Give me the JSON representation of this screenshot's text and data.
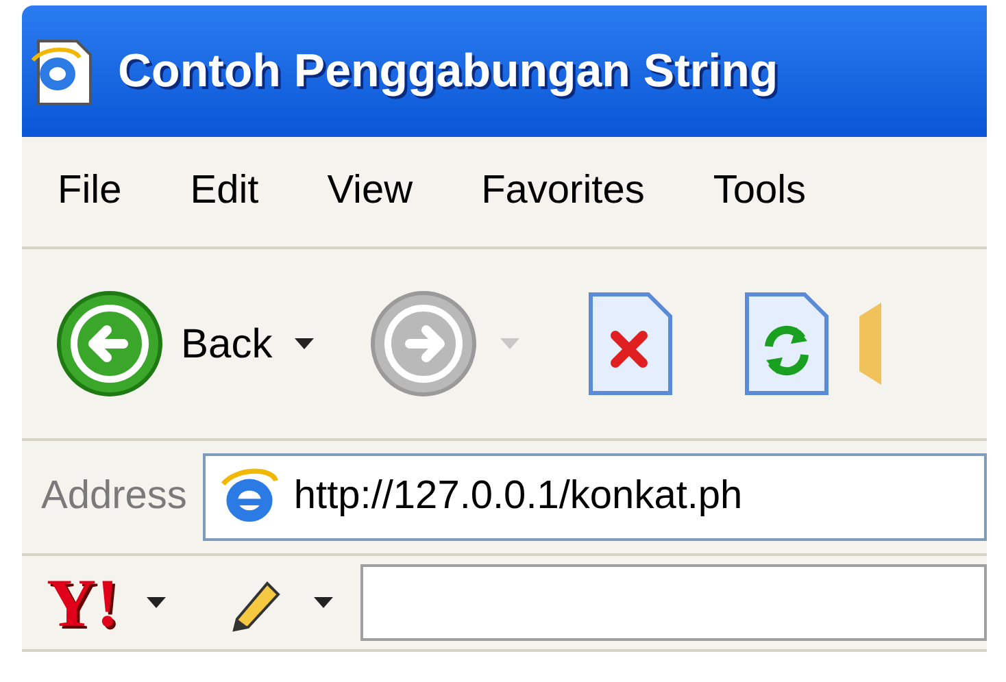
{
  "window": {
    "title": "Contoh Penggabungan String"
  },
  "menu": [
    "File",
    "Edit",
    "View",
    "Favorites",
    "Tools"
  ],
  "toolbar": {
    "back": {
      "label": "Back",
      "disabled": false
    },
    "forward": {
      "disabled": true
    }
  },
  "address": {
    "label": "Address",
    "value": "http://127.0.0.1/konkat.ph"
  },
  "yahoo": {
    "logo": "Y!"
  }
}
